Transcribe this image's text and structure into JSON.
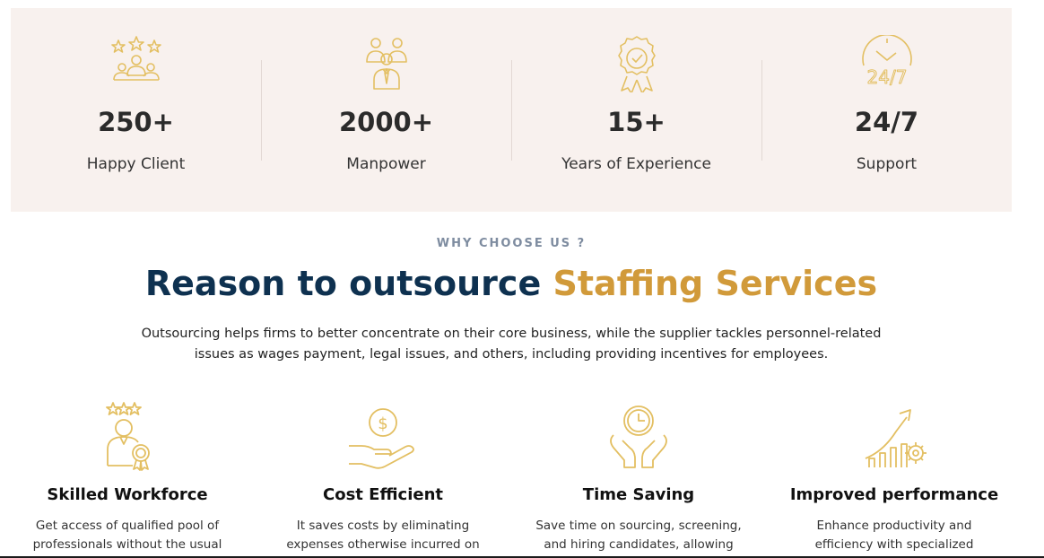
{
  "stats": [
    {
      "icon": "happy-client-icon",
      "value": "250+",
      "label": "Happy Client"
    },
    {
      "icon": "manpower-icon",
      "value": "2000+",
      "label": "Manpower"
    },
    {
      "icon": "award-ribbon-icon",
      "value": "15+",
      "label": "Years of Experience"
    },
    {
      "icon": "clock-24-7-icon",
      "value": "24/7",
      "label": "Support"
    }
  ],
  "section": {
    "eyebrow": "WHY CHOOSE US ?",
    "headline_dark": "Reason to outsource",
    "headline_gold": "Staffing Services",
    "intro": "Outsourcing helps firms to better concentrate on their core business, while the supplier tackles personnel-related issues as wages payment, legal issues, and others, including providing incentives for employees."
  },
  "features": [
    {
      "icon": "skilled-worker-icon",
      "title": "Skilled Workforce",
      "text": "Get access of qualified pool of professionals without the usual"
    },
    {
      "icon": "money-hand-icon",
      "title": "Cost Efficient",
      "text": "It saves costs by eliminating expenses otherwise incurred on recruitment &"
    },
    {
      "icon": "clock-hands-icon",
      "title": "Time Saving",
      "text": "Save time on sourcing, screening, and hiring candidates, allowing businesses"
    },
    {
      "icon": "growth-chart-icon",
      "title": "Improved performance",
      "text": "Enhance productivity and efficiency with specialized outsourcing"
    }
  ],
  "colors": {
    "accent_gold": "#d19a3a",
    "icon_gold": "#e3bf62",
    "navy": "#0e3150",
    "band_bg": "#f8f1ee"
  }
}
